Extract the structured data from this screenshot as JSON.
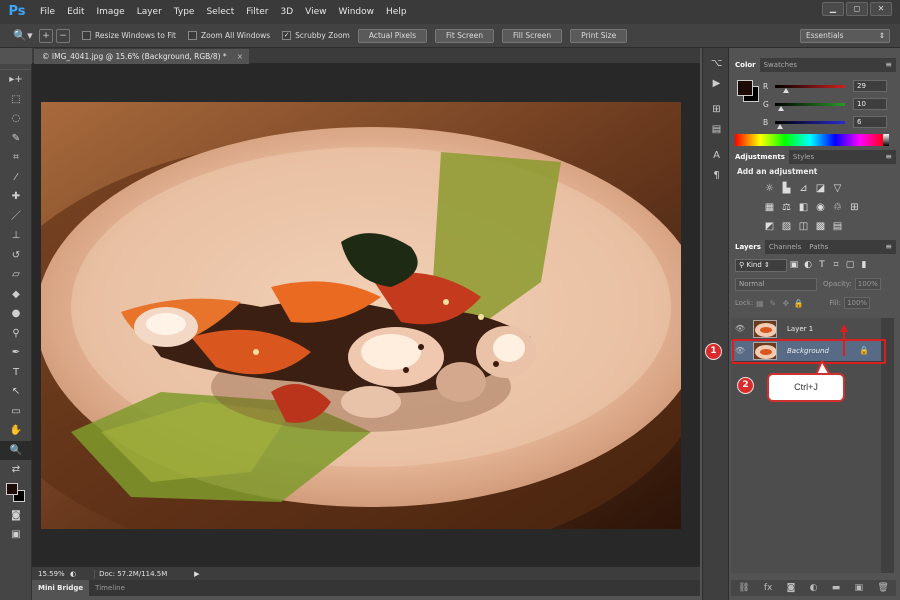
{
  "app": {
    "logo": "Ps"
  },
  "menu": [
    "File",
    "Edit",
    "Image",
    "Layer",
    "Type",
    "Select",
    "Filter",
    "3D",
    "View",
    "Window",
    "Help"
  ],
  "window_buttons": [
    "▁",
    "◻",
    "✕"
  ],
  "options": {
    "tool_icon": "zoom-tool-icon",
    "zoom_in": "+",
    "zoom_out": "−",
    "checks": [
      {
        "label": "Resize Windows to Fit",
        "checked": false
      },
      {
        "label": "Zoom All Windows",
        "checked": false
      },
      {
        "label": "Scrubby Zoom",
        "checked": true
      }
    ],
    "buttons": [
      "Actual Pixels",
      "Fit Screen",
      "Fill Screen",
      "Print Size"
    ],
    "workspace": "Essentials"
  },
  "document": {
    "tab_title": "© IMG_4041.jpg @ 15.6% (Background, RGB/8) *",
    "zoom": "15.59%",
    "doc_info": "Doc: 57.2M/114.5M"
  },
  "bottom_tabs": [
    "Mini Bridge",
    "Timeline"
  ],
  "color_panel": {
    "tabs": [
      "Color",
      "Swatches"
    ],
    "rgb": [
      {
        "label": "R",
        "value": "29",
        "fraction": 0.114,
        "color": "#d02020"
      },
      {
        "label": "G",
        "value": "10",
        "fraction": 0.039,
        "color": "#2a9a2a"
      },
      {
        "label": "B",
        "value": "6",
        "fraction": 0.024,
        "color": "#2a2ad0"
      }
    ]
  },
  "adjustments_panel": {
    "tabs": [
      "Adjustments",
      "Styles"
    ],
    "title": "Add an adjustment"
  },
  "layers_panel": {
    "tabs": [
      "Layers",
      "Channels",
      "Paths"
    ],
    "kind": "Kind",
    "blend_mode": "Normal",
    "opacity_label": "Opacity:",
    "fill_label": "Fill:",
    "lock_label": "Lock:",
    "opacity_value": "100%",
    "fill_value": "100%",
    "layers": [
      {
        "name": "Layer 1",
        "selected": false,
        "locked": false
      },
      {
        "name": "Background",
        "selected": true,
        "locked": true
      }
    ]
  },
  "annotations": {
    "badge_1": "1",
    "badge_2": "2",
    "callout": "Ctrl+J",
    "accent": "#d82020"
  }
}
